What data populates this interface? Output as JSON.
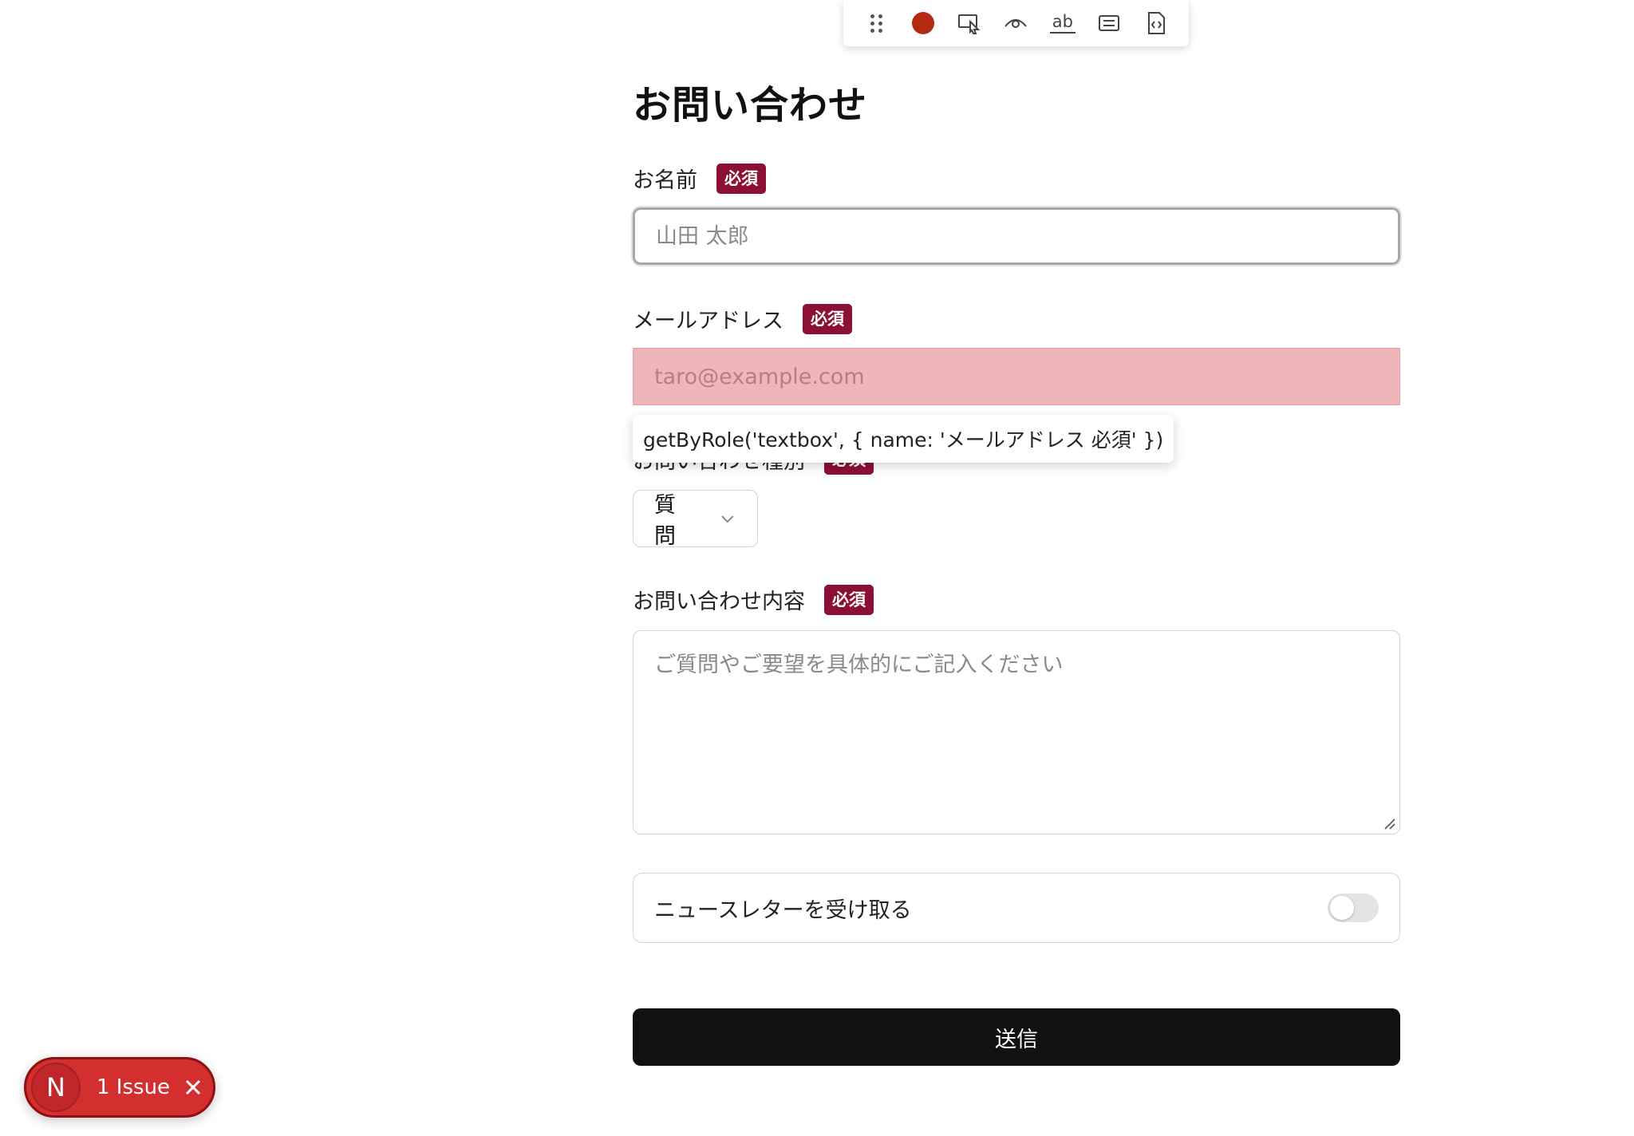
{
  "toolbar": {
    "items": [
      "drag-handle",
      "record",
      "pick-locator",
      "assert-visibility",
      "assert-text",
      "assert-value",
      "assert-snapshot"
    ],
    "record_color": "#b32a12",
    "assert_text_label": "ab"
  },
  "form": {
    "title": "お問い合わせ",
    "required_badge": "必須",
    "name": {
      "label": "お名前",
      "placeholder": "山田 太郎",
      "value": ""
    },
    "email": {
      "label": "メールアドレス",
      "placeholder": "taro@example.com",
      "value": ""
    },
    "inquiry_type": {
      "label": "お問い合わせ種別",
      "selected": "質問"
    },
    "message": {
      "label": "お問い合わせ内容",
      "placeholder": "ご質問やご要望を具体的にご記入ください"
    },
    "newsletter": {
      "label": "ニュースレターを受け取る",
      "checked": false
    },
    "submit_label": "送信"
  },
  "tooltip": {
    "text": "getByRole('textbox', { name: 'メールアドレス 必須' })"
  },
  "issues_badge": {
    "logo": "N",
    "text": "1 Issue"
  },
  "colors": {
    "required_badge": "#8e0f35",
    "highlight": "#eeb6b8",
    "submit": "#111111",
    "issues_badge": "#d32f2f"
  }
}
